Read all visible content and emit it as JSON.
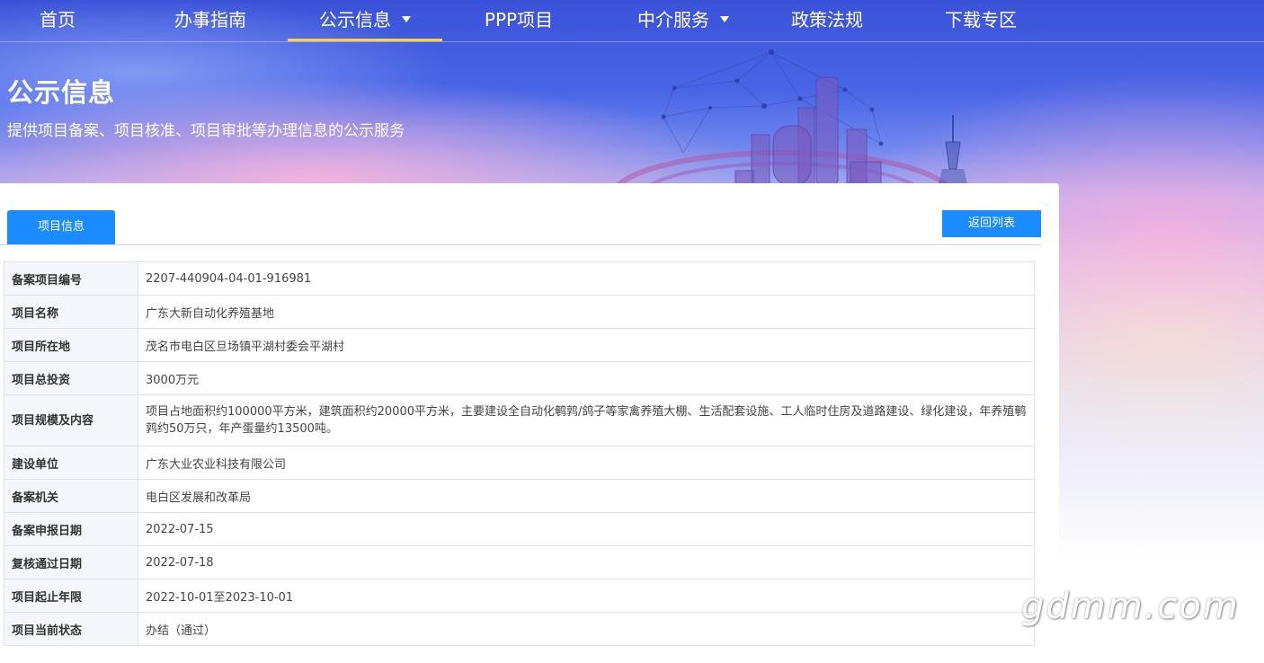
{
  "nav": {
    "items": [
      {
        "label": "首页",
        "dropdown": false,
        "active": false
      },
      {
        "label": "办事指南",
        "dropdown": false,
        "active": false
      },
      {
        "label": "公示信息",
        "dropdown": true,
        "active": true
      },
      {
        "label": "PPP项目",
        "dropdown": false,
        "active": false
      },
      {
        "label": "中介服务",
        "dropdown": true,
        "active": false
      },
      {
        "label": "政策法规",
        "dropdown": false,
        "active": false
      },
      {
        "label": "下载专区",
        "dropdown": false,
        "active": false
      }
    ],
    "accent_color": "#ffd33d"
  },
  "banner": {
    "title": "公示信息",
    "subtitle": "提供项目备案、项目核准、项目审批等办理信息的公示服务"
  },
  "panel": {
    "tab_label": "项目信息",
    "back_label": "返回列表",
    "button_color": "#1a8cff"
  },
  "project": {
    "rows": [
      {
        "label": "备案项目编号",
        "value": "2207-440904-04-01-916981"
      },
      {
        "label": "项目名称",
        "value": "广东大新自动化养殖基地"
      },
      {
        "label": "项目所在地",
        "value": "茂名市电白区旦场镇平湖村委会平湖村"
      },
      {
        "label": "项目总投资",
        "value": "3000万元"
      },
      {
        "label": "项目规模及内容",
        "value": "项目占地面积约100000平方米，建筑面积约20000平方米，主要建设全自动化鹌鹑/鸽子等家禽养殖大棚、生活配套设施、工人临时住房及道路建设、绿化建设，年养殖鹌鹑约50万只，年产蛋量约13500吨。"
      },
      {
        "label": "建设单位",
        "value": "广东大业农业科技有限公司"
      },
      {
        "label": "备案机关",
        "value": "电白区发展和改革局"
      },
      {
        "label": "备案申报日期",
        "value": "2022-07-15"
      },
      {
        "label": "复核通过日期",
        "value": "2022-07-18"
      },
      {
        "label": "项目起止年限",
        "value": "2022-10-01至2023-10-01"
      },
      {
        "label": "项目当前状态",
        "value": "办结（通过）"
      }
    ]
  },
  "watermark": "gdmm.com"
}
